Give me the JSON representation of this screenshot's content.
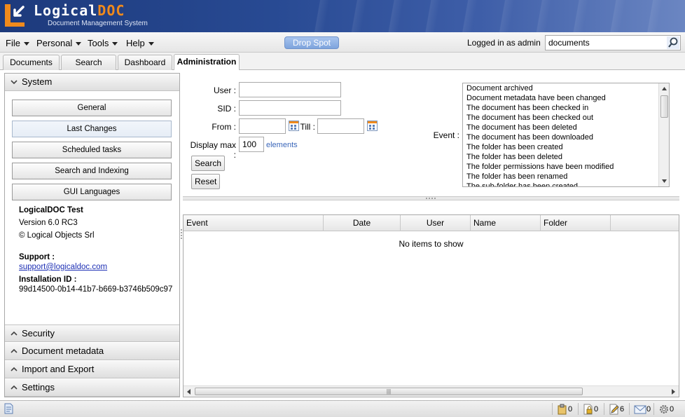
{
  "app": {
    "logo_word_1": "Logical",
    "logo_word_2": "DOC",
    "subtitle": "Document Management System"
  },
  "menu": {
    "items": [
      {
        "label": "File"
      },
      {
        "label": "Personal"
      },
      {
        "label": "Tools"
      },
      {
        "label": "Help"
      }
    ],
    "drop_spot": "Drop Spot",
    "logged_in": "Logged in as admin",
    "search_value": "documents"
  },
  "tabs": [
    {
      "label": "Documents"
    },
    {
      "label": "Search"
    },
    {
      "label": "Dashboard"
    },
    {
      "label": "Administration",
      "active": true
    }
  ],
  "sidebar": {
    "system_label": "System",
    "buttons": [
      {
        "label": "General"
      },
      {
        "label": "Last Changes",
        "selected": true
      },
      {
        "label": "Scheduled tasks"
      },
      {
        "label": "Search and Indexing"
      },
      {
        "label": "GUI Languages"
      }
    ],
    "product": "LogicalDOC Test",
    "version": "Version 6.0 RC3",
    "copyright": "© Logical Objects Srl",
    "support_label": "Support :",
    "support_email": "support@logicaldoc.com",
    "installation_label": "Installation ID :",
    "installation_id": "99d14500-0b14-41b7-b669-b3746b509c97",
    "sections": [
      {
        "label": "Security"
      },
      {
        "label": "Document metadata"
      },
      {
        "label": "Import and Export"
      },
      {
        "label": "Settings"
      }
    ]
  },
  "filters": {
    "user_label": "User :",
    "user_value": "",
    "sid_label": "SID :",
    "sid_value": "",
    "from_label": "From :",
    "from_value": "",
    "till_label": "Till :",
    "till_value": "",
    "display_max_label": "Display max :",
    "display_max_value": "100",
    "elements_label": "elements",
    "search_button": "Search",
    "reset_button": "Reset",
    "event_label": "Event :",
    "events": [
      "Document archived",
      "Document metadata have been changed",
      "The document has been checked in",
      "The document has been checked out",
      "The document has been deleted",
      "The document has been downloaded",
      "The folder has been created",
      "The folder has been deleted",
      "The folder permissions have been modified",
      "The folder has been renamed",
      "The sub-folder has been created"
    ]
  },
  "grid": {
    "columns": [
      "Event",
      "Date",
      "User",
      "Name",
      "Folder"
    ],
    "empty_text": "No items to show"
  },
  "statusbar": {
    "counters": [
      {
        "icon": "clipboard-icon",
        "value": "0"
      },
      {
        "icon": "locked-document-icon",
        "value": "0"
      },
      {
        "icon": "edit-document-icon",
        "value": "6"
      },
      {
        "icon": "mail-icon",
        "value": "0"
      },
      {
        "icon": "gear-icon",
        "value": "0"
      }
    ]
  },
  "colors": {
    "header_blue": "#284a93",
    "brand_orange": "#f08a1c",
    "link_blue": "#1d2fb4"
  }
}
